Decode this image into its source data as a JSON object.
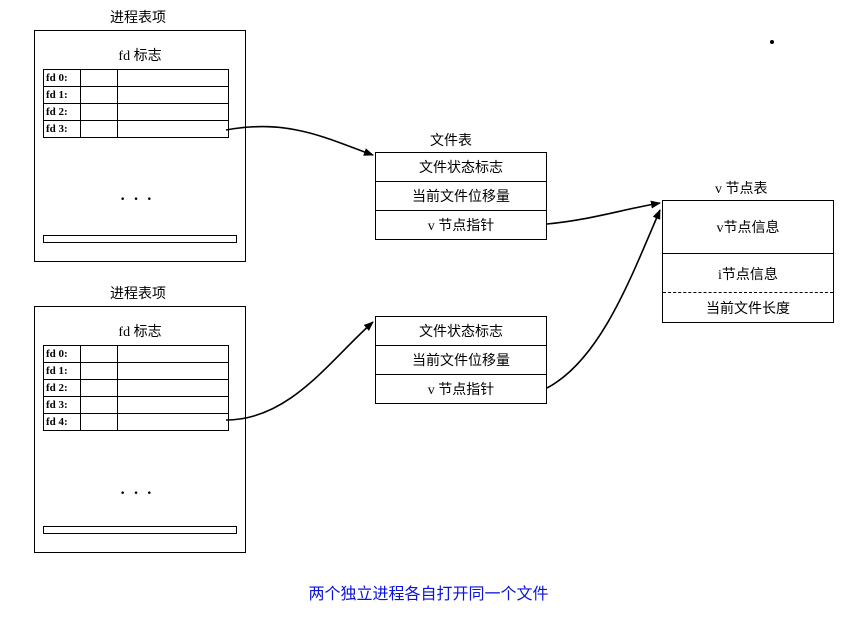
{
  "process_table": {
    "title": "进程表项",
    "fd_flag_caption": "fd 标志",
    "rows1": [
      {
        "name": "fd 0:"
      },
      {
        "name": "fd 1:"
      },
      {
        "name": "fd 2:"
      },
      {
        "name": "fd 3:"
      }
    ],
    "rows2": [
      {
        "name": "fd 0:"
      },
      {
        "name": "fd 1:"
      },
      {
        "name": "fd 2:"
      },
      {
        "name": "fd 3:"
      },
      {
        "name": "fd 4:"
      }
    ]
  },
  "file_table": {
    "title": "文件表",
    "rows": [
      "文件状态标志",
      "当前文件位移量",
      "v 节点指针"
    ]
  },
  "vnode_table": {
    "title": "v 节点表",
    "info": "v节点信息",
    "inode_info": "i节点信息",
    "length": "当前文件长度"
  },
  "caption": "两个独立进程各自打开同一个文件"
}
